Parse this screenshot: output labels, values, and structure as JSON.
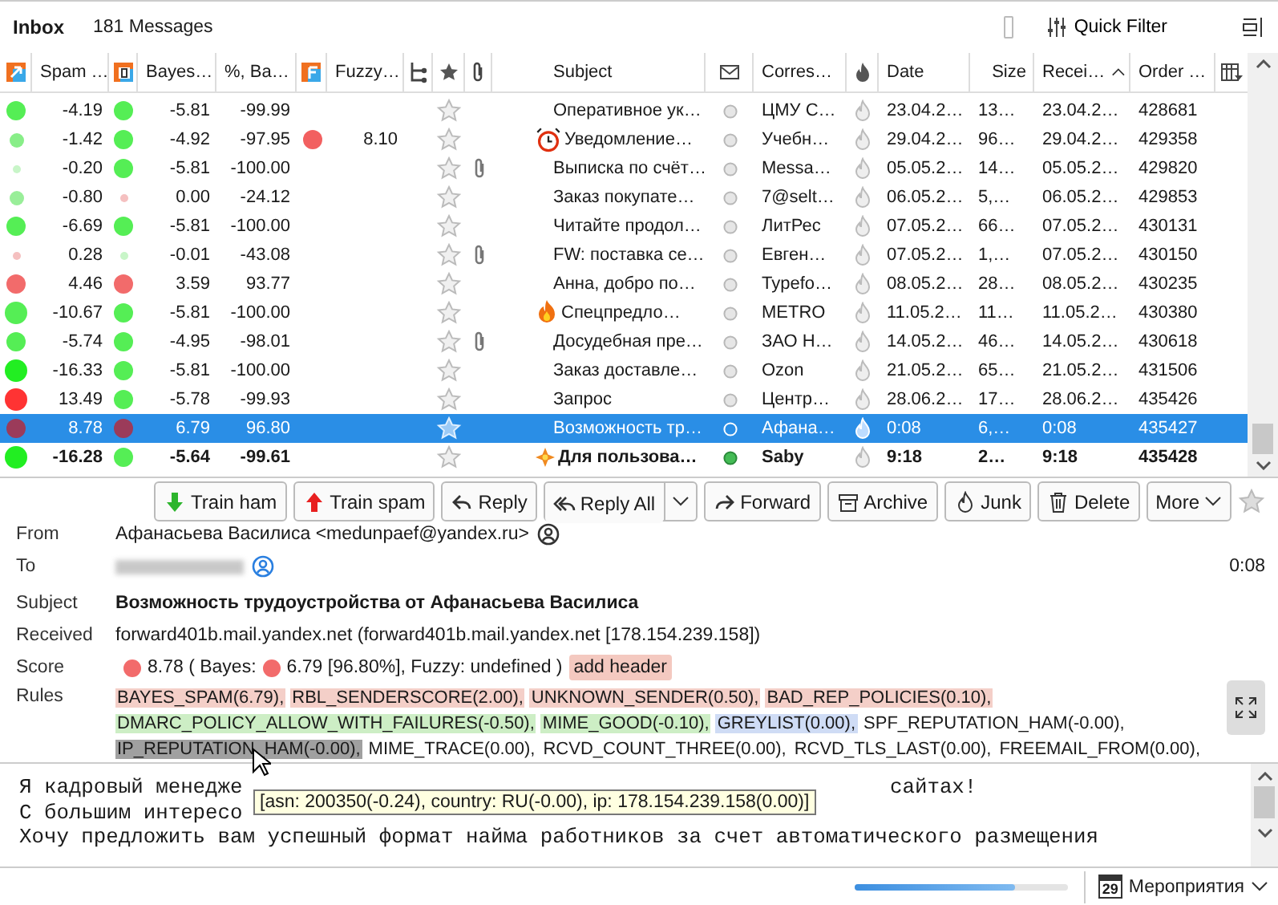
{
  "folder": {
    "name": "Inbox",
    "count": "181 Messages",
    "quick_filter": "Quick Filter"
  },
  "columns": [
    {
      "kind": "spam"
    },
    {
      "kind": "text",
      "label": "Spam …"
    },
    {
      "kind": "bayes"
    },
    {
      "kind": "text",
      "label": "Bayes…"
    },
    {
      "kind": "text",
      "label": "%, Ba…"
    },
    {
      "kind": "fuzzy"
    },
    {
      "kind": "text",
      "label": "Fuzzy…"
    },
    {
      "kind": "thread"
    },
    {
      "kind": "star"
    },
    {
      "kind": "attachment"
    },
    {
      "kind": "text",
      "label": "Subject"
    },
    {
      "kind": "read"
    },
    {
      "kind": "text",
      "label": "Corres…"
    },
    {
      "kind": "junk"
    },
    {
      "kind": "text",
      "label": "Date"
    },
    {
      "kind": "numeric",
      "label": "Size"
    },
    {
      "kind": "text",
      "label": "Recei…",
      "sorted": true
    },
    {
      "kind": "text",
      "label": "Order …"
    },
    {
      "kind": "picker"
    }
  ],
  "rows": [
    {
      "kind": "plain",
      "spam": {
        "value": "-4.19",
        "color": "#55ee55"
      },
      "bayes": {
        "value": "-5.81",
        "color": "#55ee55"
      },
      "percent": "-99.99",
      "starred": false,
      "attachment": false,
      "subject": "Оперативное ук…",
      "unread": false,
      "correspondent": "ЦМУ С…",
      "date": "23.04.2…",
      "size": "13…",
      "received": "23.04.2…",
      "order": "428681",
      "selected": false
    },
    {
      "kind": "alarm",
      "spam": {
        "value": "-1.42",
        "color": "#88ee88"
      },
      "bayes": {
        "value": "-4.92",
        "color": "#55ee55"
      },
      "percent": "-97.95",
      "fuzzy": {
        "value": "8.10",
        "color": "#f26060"
      },
      "starred": false,
      "attachment": false,
      "subject": "Уведомление…",
      "unread": false,
      "correspondent": "Учебн…",
      "date": "29.04.2…",
      "size": "96…",
      "received": "29.04.2…",
      "order": "429358",
      "selected": false
    },
    {
      "kind": "plain",
      "spam": {
        "value": "-0.20",
        "color": "#c8f5c8"
      },
      "bayes": {
        "value": "-5.81",
        "color": "#55ee55"
      },
      "percent": "-100.00",
      "starred": false,
      "attachment": true,
      "subject": "Выписка по счёт…",
      "unread": false,
      "correspondent": "Messa…",
      "date": "05.05.2…",
      "size": "14…",
      "received": "05.05.2…",
      "order": "429820",
      "selected": false
    },
    {
      "kind": "plain",
      "spam": {
        "value": "-0.80",
        "color": "#99ee99"
      },
      "bayes": {
        "value": "0.00",
        "color": "#f5c0c0"
      },
      "percent": "-24.12",
      "starred": false,
      "attachment": false,
      "subject": "Заказ покупате…",
      "unread": false,
      "correspondent": "7@selt…",
      "date": "06.05.2…",
      "size": "5,…",
      "received": "06.05.2…",
      "order": "429853",
      "selected": false
    },
    {
      "kind": "plain",
      "spam": {
        "value": "-6.69",
        "color": "#55ee55"
      },
      "bayes": {
        "value": "-5.81",
        "color": "#55ee55"
      },
      "percent": "-100.00",
      "starred": false,
      "attachment": false,
      "subject": "Читайте продол…",
      "unread": false,
      "correspondent": "ЛитРес",
      "date": "07.05.2…",
      "size": "66…",
      "received": "07.05.2…",
      "order": "430131",
      "selected": false
    },
    {
      "kind": "plain",
      "spam": {
        "value": "0.28",
        "color": "#f5c0c0"
      },
      "bayes": {
        "value": "-0.01",
        "color": "#c8f5c8"
      },
      "percent": "-43.08",
      "starred": false,
      "attachment": true,
      "subject": "FW: поставка се…",
      "unread": false,
      "correspondent": "Евген…",
      "date": "07.05.2…",
      "size": "1,…",
      "received": "07.05.2…",
      "order": "430150",
      "selected": false
    },
    {
      "kind": "plain",
      "spam": {
        "value": "4.46",
        "color": "#f26b6b"
      },
      "bayes": {
        "value": "3.59",
        "color": "#f26b6b"
      },
      "percent": "93.77",
      "starred": false,
      "attachment": false,
      "subject": "Анна, добро по…",
      "unread": false,
      "correspondent": "Typefo…",
      "date": "08.05.2…",
      "size": "28…",
      "received": "08.05.2…",
      "order": "430235",
      "selected": false
    },
    {
      "kind": "fire",
      "spam": {
        "value": "-10.67",
        "color": "#55ee55"
      },
      "bayes": {
        "value": "-5.81",
        "color": "#55ee55"
      },
      "percent": "-100.00",
      "starred": false,
      "attachment": false,
      "subject": "Спецпредло…",
      "unread": false,
      "correspondent": "METRO",
      "date": "11.05.2…",
      "size": "11…",
      "received": "11.05.2…",
      "order": "430380",
      "selected": false
    },
    {
      "kind": "plain",
      "spam": {
        "value": "-5.74",
        "color": "#55ee55"
      },
      "bayes": {
        "value": "-4.95",
        "color": "#55ee55"
      },
      "percent": "-98.01",
      "starred": false,
      "attachment": true,
      "subject": "Досудебная пре…",
      "unread": false,
      "correspondent": "ЗАО Н…",
      "date": "14.05.2…",
      "size": "46…",
      "received": "14.05.2…",
      "order": "430618",
      "selected": false
    },
    {
      "kind": "plain",
      "spam": {
        "value": "-16.33",
        "color": "#22ee22"
      },
      "bayes": {
        "value": "-5.81",
        "color": "#55ee55"
      },
      "percent": "-100.00",
      "starred": false,
      "attachment": false,
      "subject": "Заказ доставле…",
      "unread": false,
      "correspondent": "Ozon",
      "date": "21.05.2…",
      "size": "65…",
      "received": "21.05.2…",
      "order": "431506",
      "selected": false
    },
    {
      "kind": "plain",
      "spam": {
        "value": "13.49",
        "color": "#ff3333"
      },
      "bayes": {
        "value": "-5.78",
        "color": "#55ee55"
      },
      "percent": "-99.93",
      "starred": false,
      "attachment": false,
      "subject": "Запрос",
      "unread": false,
      "correspondent": "Центр…",
      "date": "28.06.2…",
      "size": "17…",
      "received": "28.06.2…",
      "order": "435426",
      "selected": false
    },
    {
      "kind": "plain",
      "spam": {
        "value": "8.78",
        "color": "#9b3b5a"
      },
      "bayes": {
        "value": "6.79",
        "color": "#9b3b5a"
      },
      "percent": "96.80",
      "starred": false,
      "attachment": false,
      "subject": "Возможность тр…",
      "unread": false,
      "correspondent": "Афана…",
      "date": "0:08",
      "size": "6,…",
      "received": "0:08",
      "order": "435427",
      "selected": true
    },
    {
      "kind": "sparkle",
      "spam": {
        "value": "-16.28",
        "color": "#22ee22"
      },
      "bayes": {
        "value": "-5.64",
        "color": "#55ee55"
      },
      "percent": "-99.61",
      "starred": false,
      "attachment": false,
      "subject": "Для пользова…",
      "unread": true,
      "correspondent": "Saby",
      "date": "9:18",
      "size": "2…",
      "received": "9:18",
      "order": "435428",
      "selected": false
    }
  ],
  "toolbar": [
    {
      "kind": "train-ham",
      "label": "Train ham"
    },
    {
      "kind": "train-spam",
      "label": "Train spam"
    },
    {
      "kind": "reply",
      "label": "Reply"
    },
    {
      "kind": "reply-all",
      "label": "Reply All"
    },
    {
      "kind": "forward",
      "label": "Forward"
    },
    {
      "kind": "archive",
      "label": "Archive"
    },
    {
      "kind": "junk",
      "label": "Junk"
    },
    {
      "kind": "delete",
      "label": "Delete"
    },
    {
      "kind": "more",
      "label": "More"
    }
  ],
  "message": {
    "from_label": "From",
    "from": "Афанасьева Василиса <medunpaef@yandex.ru>",
    "to_label": "To",
    "time": "0:08",
    "subject_label": "Subject",
    "subject": "Возможность трудоустройства от Афанасьева Василиса",
    "received_label": "Received",
    "received": "forward401b.mail.yandex.net (forward401b.mail.yandex.net [178.154.239.158])",
    "score_label": "Score",
    "score": {
      "value": "8.78",
      "color": "#f26b6b"
    },
    "bayes_text": "( Bayes:",
    "bayes": {
      "value": "6.79",
      "color": "#f26b6b"
    },
    "score_detail": "[96.80%], Fuzzy:  undefined )",
    "add_header": "add header",
    "rules_label": "Rules",
    "rules": [
      {
        "tags": [
          {
            "text": "BAYES_SPAM(6.79),",
            "kind": "spam"
          },
          {
            "text": "RBL_SENDERSCORE(2.00),",
            "kind": "spam"
          },
          {
            "text": "UNKNOWN_SENDER(0.50),",
            "kind": "spam"
          },
          {
            "text": "BAD_REP_POLICIES(0.10),",
            "kind": "spam"
          }
        ]
      },
      {
        "tags": [
          {
            "text": "DMARC_POLICY_ALLOW_WITH_FAILURES(-0.50),",
            "kind": "ham"
          },
          {
            "text": "MIME_GOOD(-0.10),",
            "kind": "ham"
          },
          {
            "text": "GREYLIST(0.00),",
            "kind": "neutral"
          },
          {
            "text": "SPF_REPUTATION_HAM(-0.00),",
            "kind": "plain"
          }
        ]
      },
      {
        "tags": [
          {
            "text": "IP_REPUTATION_HAM(-0.00),",
            "kind": "hovered"
          },
          {
            "text": "MIME_TRACE(0.00),",
            "kind": "plain"
          },
          {
            "text": "RCVD_COUNT_THREE(0.00),",
            "kind": "plain"
          },
          {
            "text": "RCVD_TLS_LAST(0.00),",
            "kind": "plain"
          },
          {
            "text": "FREEMAIL_FROM(0.00),",
            "kind": "plain"
          }
        ]
      }
    ],
    "tooltip": "[asn: 200350(-0.24), country: RU(-0.00), ip: 178.154.239.158(0.00)]",
    "body": [
      {
        "before": "Я кадровый менедже",
        "after": "сайтах!"
      },
      {
        "before": "С большим интересо"
      },
      {
        "before": "Хочу предложить вам успешный формат найма работников за счет автоматического размещения"
      }
    ]
  },
  "status": {
    "level": 0.75,
    "calendar_day": "29",
    "events": "Мероприятия"
  }
}
